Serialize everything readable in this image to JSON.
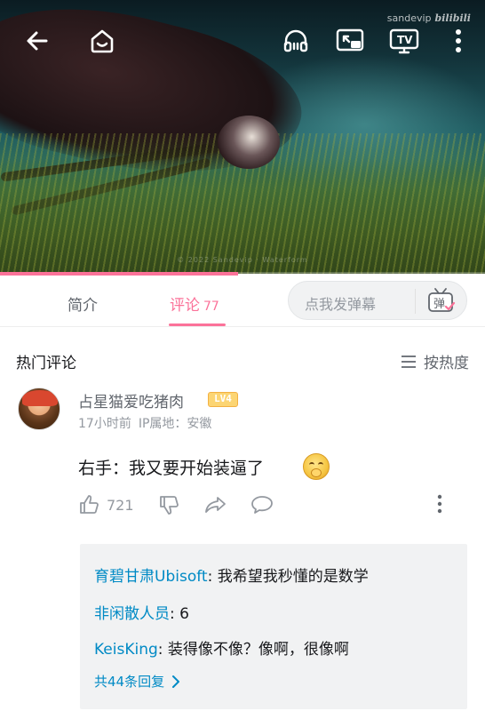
{
  "video": {
    "watermark": "© 2022 Sandevip · Waterform",
    "brand_user": "sandevip",
    "brand_logo": "bilibili",
    "progress": 0.49,
    "top_icons": [
      "back-arrow-icon",
      "home-icon",
      "headphones-icon",
      "screen-cast-icon",
      "tv-icon",
      "more-vertical-icon"
    ]
  },
  "tabs": [
    {
      "label": "简介"
    },
    {
      "label": "评论",
      "count": "77"
    }
  ],
  "danmu": {
    "placeholder": "点我发弹幕",
    "icon_text": "弹"
  },
  "comments": {
    "section_title": "热门评论",
    "sort_label": "按热度"
  },
  "comment": {
    "username": "占星猫爱吃猪肉",
    "level": "LV4",
    "time": "17小时前",
    "ip": "IP属地：安徽",
    "text": "右手：我又要开始装逼了",
    "likes": "721"
  },
  "replies": [
    {
      "name": "育碧甘肃Ubisoft",
      "text": ": 我希望我秒懂的是数学"
    },
    {
      "name": "非闲散人员",
      "text": ": 6"
    },
    {
      "name": "KeisKing",
      "text": ": 装得像不像？像啊，很像啊"
    }
  ],
  "replies_more": "共44条回复",
  "colors": {
    "accent": "#fb7299",
    "link": "#008ac5",
    "level_badge": "#fcd573"
  }
}
